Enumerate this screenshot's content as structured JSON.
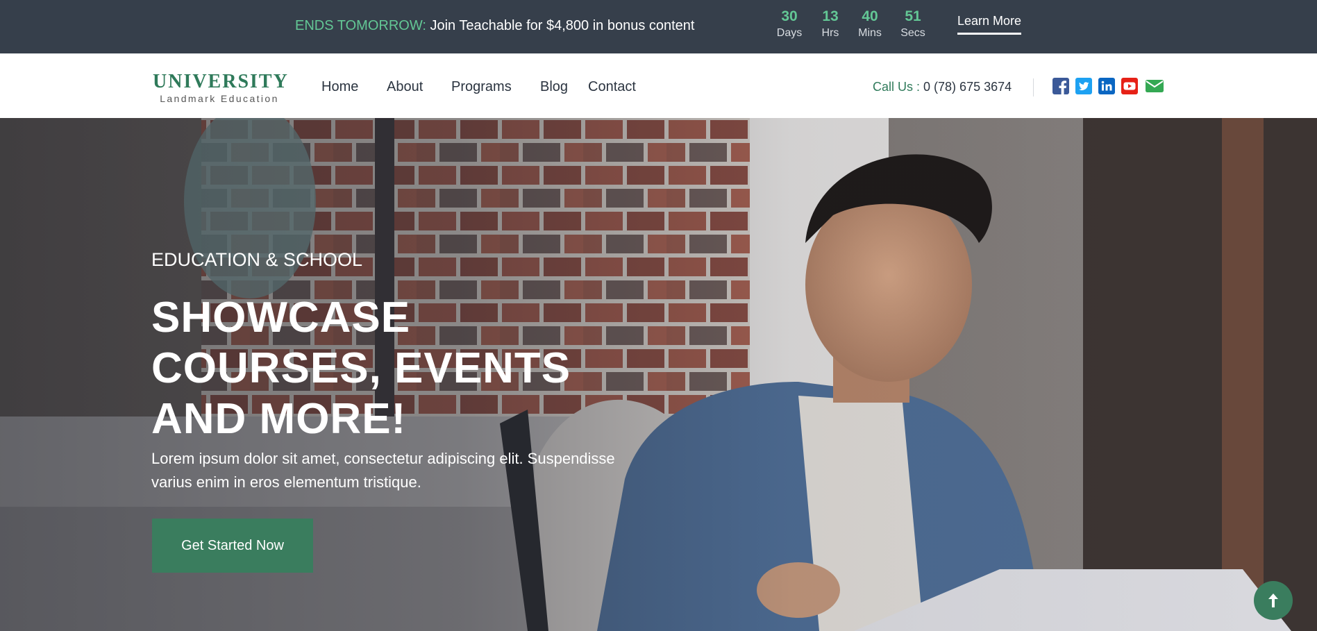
{
  "promo": {
    "highlight": "ENDS TOMORROW:",
    "message": " Join Teachable for $4,800 in bonus content",
    "countdown": [
      {
        "value": "30",
        "unit": "Days"
      },
      {
        "value": "13",
        "unit": "Hrs"
      },
      {
        "value": "40",
        "unit": "Mins"
      },
      {
        "value": "51",
        "unit": "Secs"
      }
    ],
    "cta_label": "Learn More"
  },
  "header": {
    "logo_title": "UNIVERSITY",
    "logo_subtitle": "Landmark Education",
    "menu": [
      "Home",
      "About",
      "Programs",
      "Blog",
      "Contact"
    ],
    "call_label": "Call Us :",
    "phone": "0 (78) 675 3674",
    "social": [
      {
        "icon": "facebook-icon",
        "color": "#3b5998"
      },
      {
        "icon": "twitter-icon",
        "color": "#1da1f2"
      },
      {
        "icon": "linkedin-icon",
        "color": "#0a66c2"
      },
      {
        "icon": "youtube-icon",
        "color": "#e62117"
      },
      {
        "icon": "email-icon",
        "color": "#34a853"
      }
    ]
  },
  "hero": {
    "eyebrow": "EDUCATION & SCHOOL",
    "title": "SHOWCASE COURSES, EVENTS AND MORE!",
    "body": "Lorem ipsum dolor sit amet, consectetur adipiscing elit. Suspendisse varius enim in eros elementum tristique.",
    "cta_label": "Get Started Now"
  },
  "back_to_top": {
    "icon": "arrow-up-icon"
  },
  "colors": {
    "accent": "#3a7d5e",
    "highlight_green": "#63c795",
    "promo_bg": "#363f4b"
  }
}
